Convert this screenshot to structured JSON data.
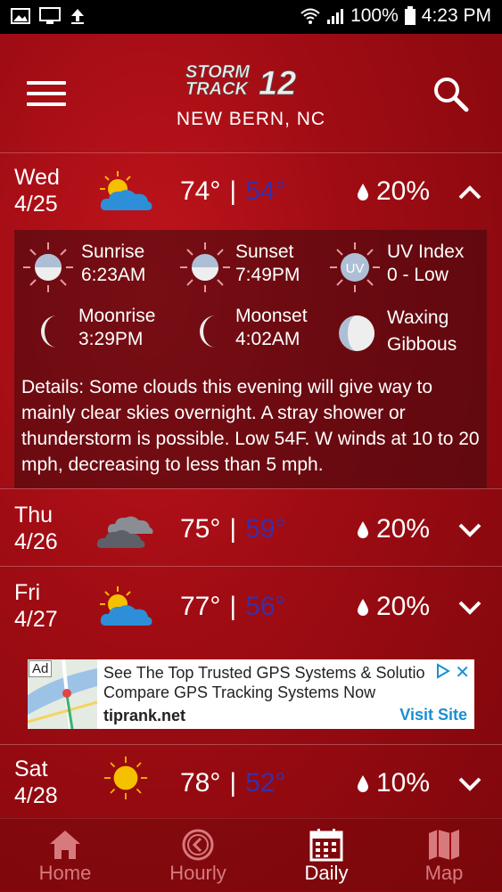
{
  "status_bar": {
    "battery": "100%",
    "time": "4:23 PM"
  },
  "header": {
    "location": "NEW BERN, NC",
    "logo_line1": "STORM",
    "logo_line2": "TRACK",
    "logo_num": "12"
  },
  "days": [
    {
      "day": "Wed",
      "date": "4/25",
      "icon": "partly-cloudy-icon",
      "high": "74°",
      "low": "54°",
      "precip": "20%",
      "expanded": true
    },
    {
      "day": "Thu",
      "date": "4/26",
      "icon": "cloudy-icon",
      "high": "75°",
      "low": "59°",
      "precip": "20%",
      "expanded": false
    },
    {
      "day": "Fri",
      "date": "4/27",
      "icon": "partly-cloudy-icon",
      "high": "77°",
      "low": "56°",
      "precip": "20%",
      "expanded": false
    },
    {
      "day": "Sat",
      "date": "4/28",
      "icon": "sunny-icon",
      "high": "78°",
      "low": "52°",
      "precip": "10%",
      "expanded": false
    }
  ],
  "separator": "|",
  "details": {
    "sunrise_label": "Sunrise",
    "sunrise_value": "6:23AM",
    "sunset_label": "Sunset",
    "sunset_value": "7:49PM",
    "uv_label": "UV Index",
    "uv_value": "0 - Low",
    "uv_badge": "UV",
    "moonrise_label": "Moonrise",
    "moonrise_value": "3:29PM",
    "moonset_label": "Moonset",
    "moonset_value": "4:02AM",
    "phase_line1": "Waxing",
    "phase_line2": "Gibbous",
    "text": "Details: Some clouds this evening will give way to mainly clear skies overnight. A stray shower or thunderstorm is possible. Low 54F. W winds at 10 to 20 mph, decreasing to less than 5 mph."
  },
  "ad": {
    "badge": "Ad",
    "line1": "See The Top Trusted GPS Systems & Solutio",
    "line2": "Compare GPS Tracking Systems Now",
    "domain": "tiprank.net",
    "cta": "Visit Site",
    "close": "✕"
  },
  "nav": [
    {
      "label": "Home",
      "icon": "home-icon",
      "active": false
    },
    {
      "label": "Hourly",
      "icon": "clock-icon",
      "active": false
    },
    {
      "label": "Daily",
      "icon": "calendar-icon",
      "active": true
    },
    {
      "label": "Map",
      "icon": "map-icon",
      "active": false
    }
  ],
  "colors": {
    "background": "#9c0a10",
    "low_temp": "#3a2fa8",
    "ad_accent": "#1a8fd1"
  }
}
